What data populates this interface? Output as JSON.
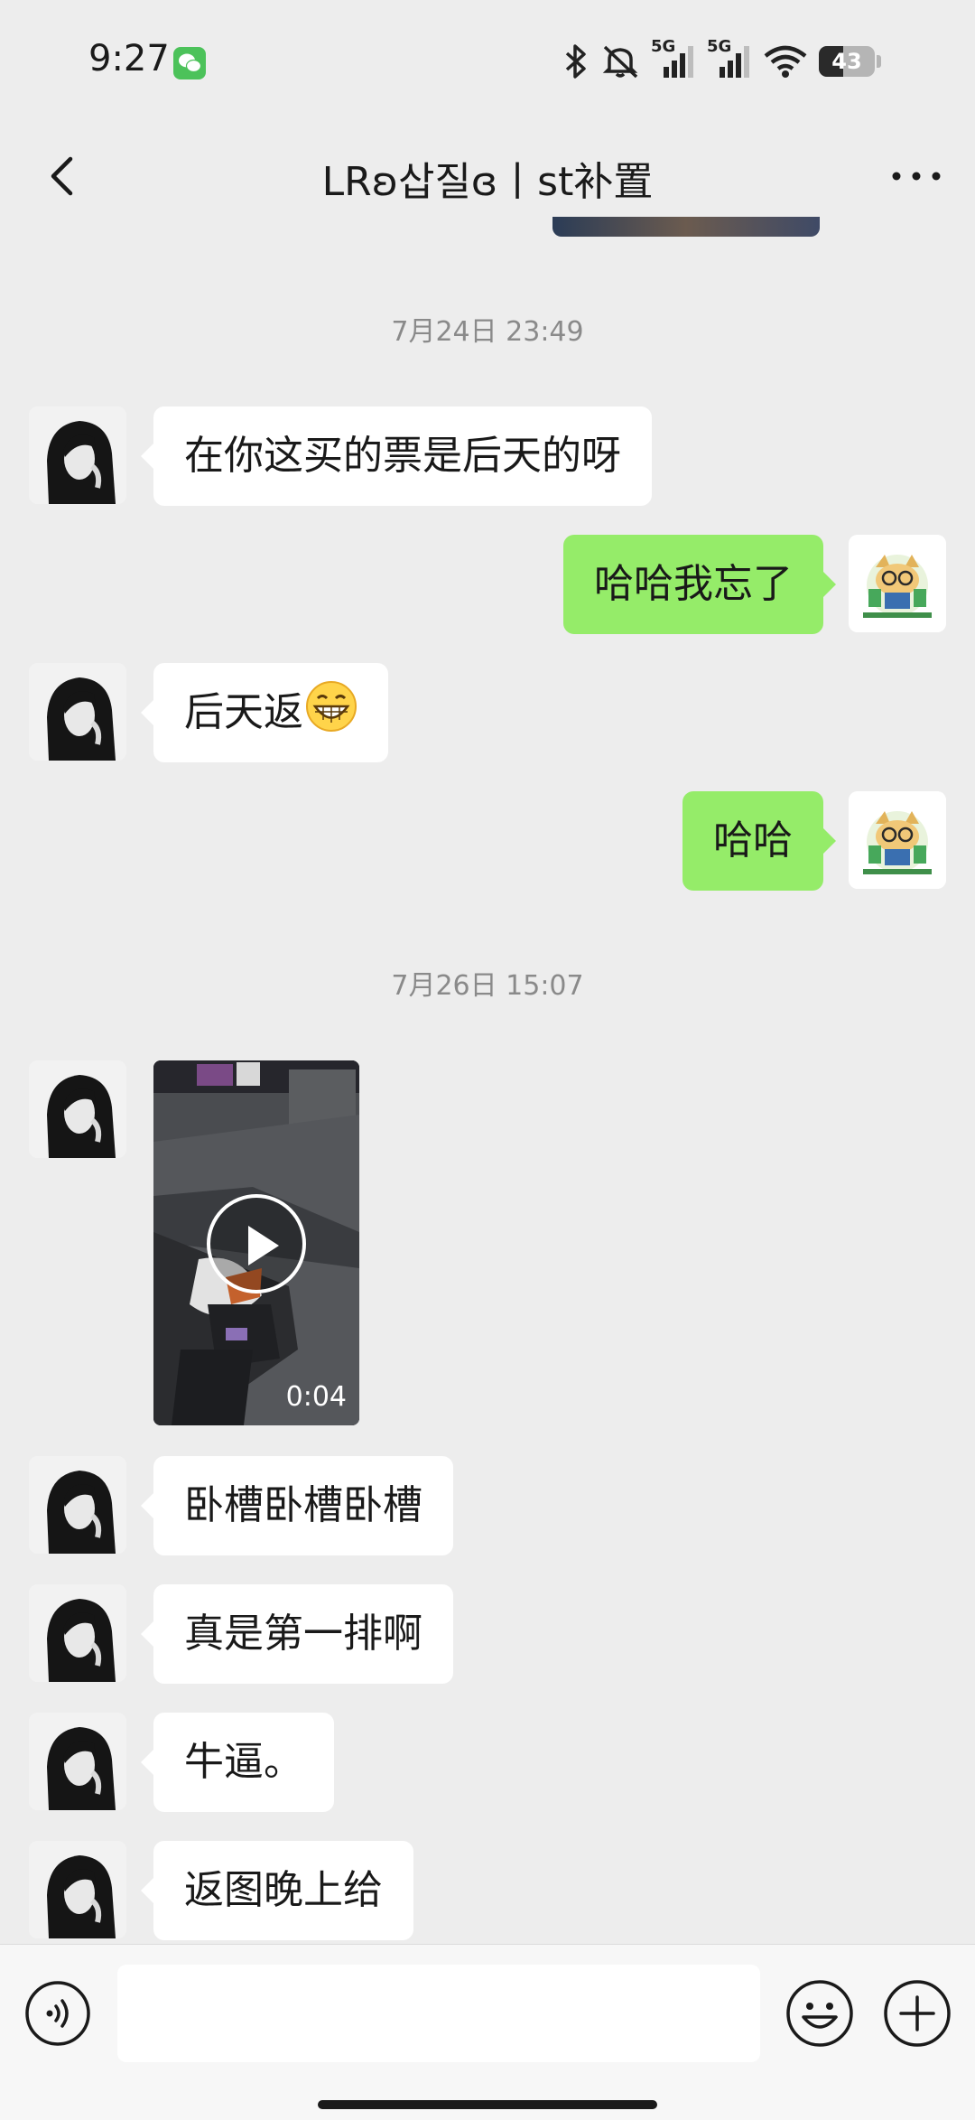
{
  "status_bar": {
    "time": "9:27",
    "network_1": "5G",
    "network_2": "5G",
    "battery_level": "43",
    "icons": [
      "wechat-icon",
      "bluetooth-icon",
      "mute-icon",
      "signal-icon",
      "wifi-icon",
      "battery-icon"
    ]
  },
  "nav": {
    "title": "LRʚ삽질ɞ丨st补置",
    "back_icon": "chevron-left-icon",
    "more_icon": "more-dots-icon"
  },
  "chat": {
    "timestamps": [
      "7月24日 23:49",
      "7月26日 15:07"
    ],
    "messages": [
      {
        "from": "other",
        "type": "text",
        "text": "在你这买的票是后天的呀"
      },
      {
        "from": "me",
        "type": "text",
        "text": "哈哈我忘了"
      },
      {
        "from": "other",
        "type": "text",
        "text": "后天返",
        "emoji": "grinning-face"
      },
      {
        "from": "me",
        "type": "text",
        "text": "哈哈"
      },
      {
        "from": "other",
        "type": "video",
        "duration": "0:04"
      },
      {
        "from": "other",
        "type": "text",
        "text": "卧槽卧槽卧槽"
      },
      {
        "from": "other",
        "type": "text",
        "text": "真是第一排啊"
      },
      {
        "from": "other",
        "type": "text",
        "text": "牛逼。"
      },
      {
        "from": "other",
        "type": "text",
        "text": "返图晚上给"
      }
    ]
  },
  "input_bar": {
    "value": "",
    "icons": [
      "voice-icon",
      "emoji-icon",
      "plus-icon"
    ]
  },
  "colors": {
    "background": "#ededed",
    "outgoing_bubble": "#95ec69",
    "incoming_bubble": "#ffffff",
    "timestamp": "#8a8a8a"
  }
}
